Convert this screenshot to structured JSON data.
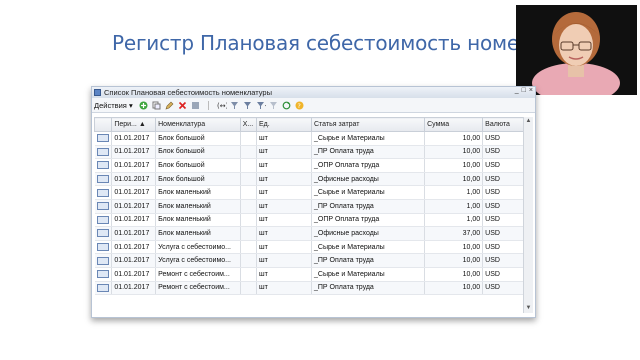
{
  "slide": {
    "title": "Регистр Плановая себестоимость номенклатуры"
  },
  "window": {
    "title": "Список Плановая себестоимость номенклатуры",
    "controls": [
      "_",
      "□",
      "×"
    ]
  },
  "toolbar": {
    "actions_label": "Действия ▾"
  },
  "columns": [
    "Пери...",
    "Номенклатура",
    "Х...",
    "Ед.",
    "Статья затрат",
    "Сумма",
    "Валюта"
  ],
  "rows": [
    {
      "period": "01.01.2017",
      "item": "Блок большой",
      "x": "",
      "unit": "шт",
      "cost": "_Сырье и Материалы",
      "sum": "10,00",
      "cur": "USD"
    },
    {
      "period": "01.01.2017",
      "item": "Блок большой",
      "x": "",
      "unit": "шт",
      "cost": "_ПР Оплата труда",
      "sum": "10,00",
      "cur": "USD"
    },
    {
      "period": "01.01.2017",
      "item": "Блок большой",
      "x": "",
      "unit": "шт",
      "cost": "_ОПР Оплата труда",
      "sum": "10,00",
      "cur": "USD"
    },
    {
      "period": "01.01.2017",
      "item": "Блок большой",
      "x": "",
      "unit": "шт",
      "cost": "_Офисные расходы",
      "sum": "10,00",
      "cur": "USD"
    },
    {
      "period": "01.01.2017",
      "item": "Блок маленький",
      "x": "",
      "unit": "шт",
      "cost": "_Сырье и Материалы",
      "sum": "1,00",
      "cur": "USD"
    },
    {
      "period": "01.01.2017",
      "item": "Блок маленький",
      "x": "",
      "unit": "шт",
      "cost": "_ПР Оплата труда",
      "sum": "1,00",
      "cur": "USD"
    },
    {
      "period": "01.01.2017",
      "item": "Блок маленький",
      "x": "",
      "unit": "шт",
      "cost": "_ОПР Оплата труда",
      "sum": "1,00",
      "cur": "USD"
    },
    {
      "period": "01.01.2017",
      "item": "Блок маленький",
      "x": "",
      "unit": "шт",
      "cost": "_Офисные расходы",
      "sum": "37,00",
      "cur": "USD"
    },
    {
      "period": "01.01.2017",
      "item": "Услуга с себестоимо...",
      "x": "",
      "unit": "шт",
      "cost": "_Сырье и Материалы",
      "sum": "10,00",
      "cur": "USD"
    },
    {
      "period": "01.01.2017",
      "item": "Услуга с себестоимо...",
      "x": "",
      "unit": "шт",
      "cost": "_ПР Оплата труда",
      "sum": "10,00",
      "cur": "USD"
    },
    {
      "period": "01.01.2017",
      "item": "Ремонт с себестоим...",
      "x": "",
      "unit": "шт",
      "cost": "_Сырье и Материалы",
      "sum": "10,00",
      "cur": "USD"
    },
    {
      "period": "01.01.2017",
      "item": "Ремонт с себестоим...",
      "x": "",
      "unit": "шт",
      "cost": "_ПР Оплата труда",
      "sum": "10,00",
      "cur": "USD"
    }
  ]
}
